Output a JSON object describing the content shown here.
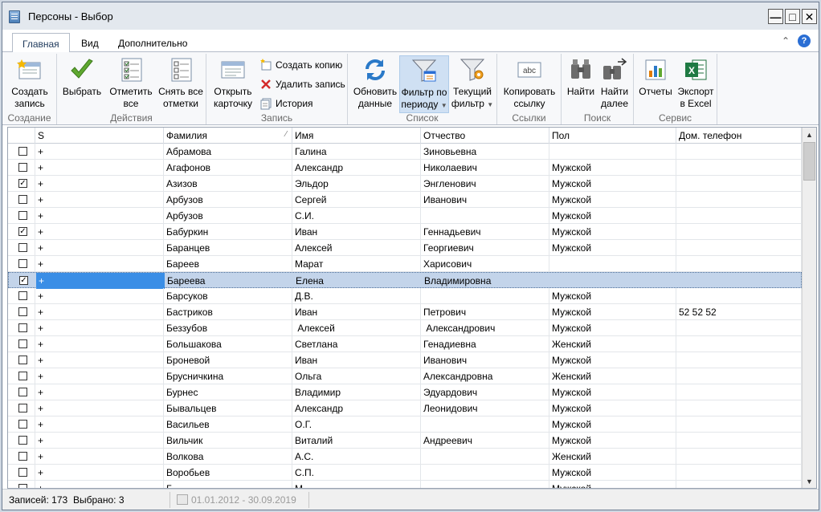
{
  "window": {
    "title": "Персоны - Выбор"
  },
  "tabs": [
    "Главная",
    "Вид",
    "Дополнительно"
  ],
  "ribbon": {
    "groups": {
      "create": "Создание",
      "actions": "Действия",
      "record": "Запись",
      "list": "Список",
      "links": "Ссылки",
      "search": "Поиск",
      "service": "Сервис"
    },
    "create_record": [
      "Создать",
      "запись"
    ],
    "select": "Выбрать",
    "mark_all": [
      "Отметить",
      "все"
    ],
    "unmark_all": [
      "Снять все",
      "отметки"
    ],
    "open_card": [
      "Открыть",
      "карточку"
    ],
    "create_copy": "Создать копию",
    "delete_record": "Удалить запись",
    "history": "История",
    "refresh": [
      "Обновить",
      "данные"
    ],
    "filter_period": [
      "Фильтр по",
      "периоду"
    ],
    "current_filter": [
      "Текущий",
      "фильтр"
    ],
    "copy_link": [
      "Копировать",
      "ссылку"
    ],
    "find": "Найти",
    "find_next": [
      "Найти",
      "далее"
    ],
    "reports": "Отчеты",
    "export_excel": [
      "Экспорт",
      "в Excel"
    ]
  },
  "grid": {
    "columns": [
      "S",
      "Фамилия",
      "Имя",
      "Отчество",
      "Пол",
      "Дом. телефон"
    ],
    "rows": [
      {
        "checked": false,
        "s": "+",
        "last": "Абрамова",
        "first": "Галина",
        "middle": "Зиновьевна",
        "sex": "",
        "phone": ""
      },
      {
        "checked": false,
        "s": "+",
        "last": "Агафонов",
        "first": "Александр",
        "middle": "Николаевич",
        "sex": "Мужской",
        "phone": ""
      },
      {
        "checked": true,
        "s": "+",
        "last": "Азизов",
        "first": "Эльдор",
        "middle": "Энгленович",
        "sex": "Мужской",
        "phone": ""
      },
      {
        "checked": false,
        "s": "+",
        "last": "Арбузов",
        "first": "Сергей",
        "middle": "Иванович",
        "sex": "Мужской",
        "phone": ""
      },
      {
        "checked": false,
        "s": "+",
        "last": "Арбузов",
        "first": "С.И.",
        "middle": "",
        "sex": "Мужской",
        "phone": ""
      },
      {
        "checked": true,
        "s": "+",
        "last": "Бабуркин",
        "first": "Иван",
        "middle": "Геннадьевич",
        "sex": "Мужской",
        "phone": ""
      },
      {
        "checked": false,
        "s": "+",
        "last": "Баранцев",
        "first": "Алексей",
        "middle": "Георгиевич",
        "sex": "Мужской",
        "phone": ""
      },
      {
        "checked": false,
        "s": "+",
        "last": "Бареев",
        "first": "Марат",
        "middle": "Харисович",
        "sex": "",
        "phone": ""
      },
      {
        "checked": true,
        "s": "+",
        "last": "Бареева",
        "first": "Елена",
        "middle": "Владимировна",
        "sex": "",
        "phone": "",
        "selected": true
      },
      {
        "checked": false,
        "s": "+",
        "last": "Барсуков",
        "first": "Д.В.",
        "middle": "",
        "sex": "Мужской",
        "phone": ""
      },
      {
        "checked": false,
        "s": "+",
        "last": "Бастриков",
        "first": "Иван",
        "middle": "Петрович",
        "sex": "Мужской",
        "phone": "52 52 52"
      },
      {
        "checked": false,
        "s": "+",
        "last": "Беззубов",
        "first": " Алексей",
        "middle": " Александрович",
        "sex": "Мужской",
        "phone": ""
      },
      {
        "checked": false,
        "s": "+",
        "last": "Большакова",
        "first": "Светлана",
        "middle": "Генадиевна",
        "sex": "Женский",
        "phone": ""
      },
      {
        "checked": false,
        "s": "+",
        "last": "Броневой",
        "first": "Иван",
        "middle": "Иванович",
        "sex": "Мужской",
        "phone": ""
      },
      {
        "checked": false,
        "s": "+",
        "last": "Брусничкина",
        "first": "Ольга",
        "middle": "Александровна",
        "sex": "Женский",
        "phone": ""
      },
      {
        "checked": false,
        "s": "+",
        "last": "Бурнес",
        "first": "Владимир",
        "middle": "Эдуардович",
        "sex": "Мужской",
        "phone": ""
      },
      {
        "checked": false,
        "s": "+",
        "last": "Бывальцев",
        "first": "Александр",
        "middle": "Леонидович",
        "sex": "Мужской",
        "phone": ""
      },
      {
        "checked": false,
        "s": "+",
        "last": "Васильев",
        "first": "О.Г.",
        "middle": "",
        "sex": "Мужской",
        "phone": ""
      },
      {
        "checked": false,
        "s": "+",
        "last": "Вильчик",
        "first": "Виталий",
        "middle": "Андреевич",
        "sex": "Мужской",
        "phone": ""
      },
      {
        "checked": false,
        "s": "+",
        "last": "Волкова",
        "first": "А.С.",
        "middle": "",
        "sex": "Женский",
        "phone": ""
      },
      {
        "checked": false,
        "s": "+",
        "last": "Воробьев",
        "first": "С.П.",
        "middle": "",
        "sex": "Мужской",
        "phone": ""
      },
      {
        "checked": false,
        "s": "+",
        "last": "Г",
        "first": "М",
        "middle": "",
        "sex": "Мужской",
        "phone": ""
      }
    ]
  },
  "status": {
    "records": "Записей: 173",
    "selected": "Выбрано: 3",
    "period": "01.01.2012 - 30.09.2019"
  },
  "colors": {
    "accent": "#2a6ed4",
    "selection": "#c3d4ea",
    "selected_cell": "#3a8ee6"
  }
}
